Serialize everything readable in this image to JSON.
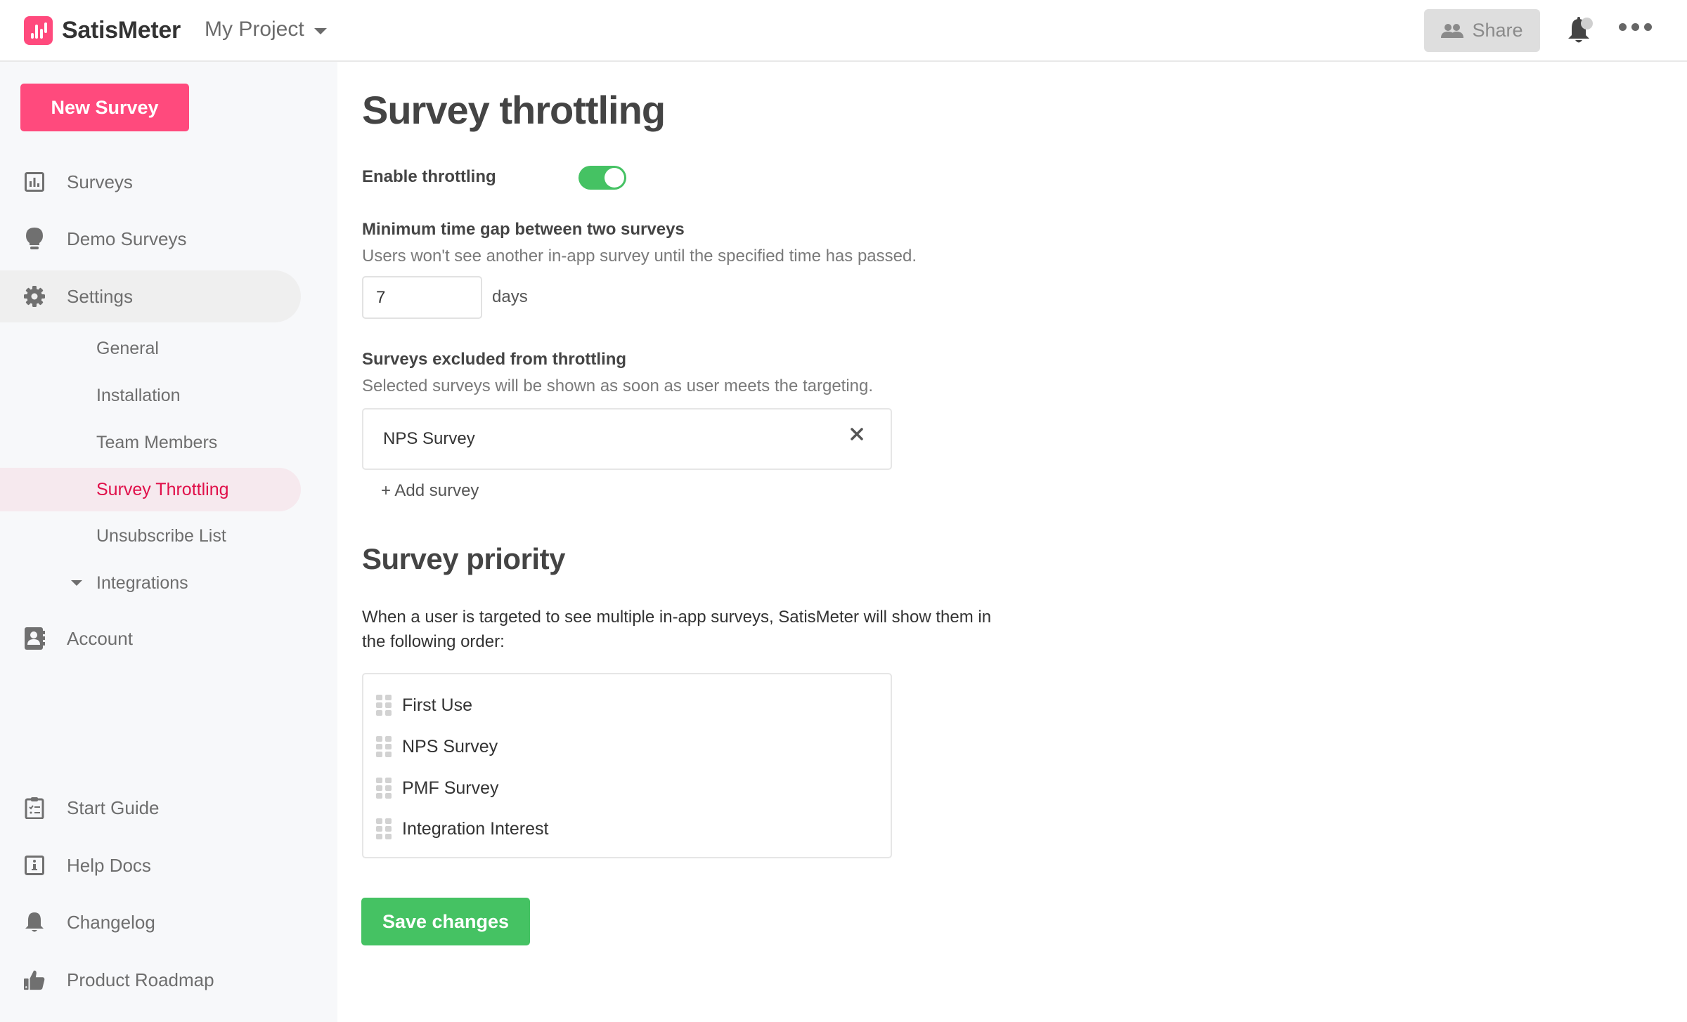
{
  "header": {
    "brand": "SatisMeter",
    "project": "My Project",
    "share_label": "Share",
    "icons": {
      "logo": "bar-chart-logo",
      "project_dropdown": "caret-down-icon",
      "share": "users-icon",
      "notifications": "bell-icon",
      "more": "ellipsis-icon"
    }
  },
  "sidebar": {
    "new_survey_label": "New Survey",
    "items": [
      {
        "label": "Surveys",
        "icon": "bar-chart-square-icon"
      },
      {
        "label": "Demo Surveys",
        "icon": "lightbulb-icon"
      },
      {
        "label": "Settings",
        "icon": "gear-icon",
        "expanded": true
      }
    ],
    "settings_subitems": [
      {
        "label": "General"
      },
      {
        "label": "Installation"
      },
      {
        "label": "Team Members"
      },
      {
        "label": "Survey Throttling",
        "active": true
      },
      {
        "label": "Unsubscribe List"
      },
      {
        "label": "Integrations",
        "collapsible": true
      }
    ],
    "account": {
      "label": "Account",
      "icon": "address-book-icon"
    },
    "bottom_items": [
      {
        "label": "Start Guide",
        "icon": "clipboard-checklist-icon"
      },
      {
        "label": "Help Docs",
        "icon": "info-square-icon"
      },
      {
        "label": "Changelog",
        "icon": "bell-icon"
      },
      {
        "label": "Product Roadmap",
        "icon": "thumbs-up-icon"
      }
    ]
  },
  "main": {
    "title": "Survey throttling",
    "enable_throttling": {
      "label": "Enable throttling",
      "enabled": true
    },
    "min_gap": {
      "label": "Minimum time gap between two surveys",
      "help": "Users won't see another in-app survey until the specified time has passed.",
      "value": "7",
      "unit": "days"
    },
    "excluded": {
      "label": "Surveys excluded from throttling",
      "help": "Selected surveys will be shown as soon as user meets the targeting.",
      "surveys": [
        "NPS Survey"
      ],
      "add_label": "+ Add survey"
    },
    "priority": {
      "title": "Survey priority",
      "description": "When a user is targeted to see multiple in-app surveys, SatisMeter will show them in the following order:",
      "items": [
        "First Use",
        "NPS Survey",
        "PMF Survey",
        "Integration Interest"
      ]
    },
    "save_label": "Save changes"
  },
  "colors": {
    "brand_pink": "#ff4a7d",
    "active_nav_text": "#e0104a",
    "success_green": "#45c263"
  }
}
